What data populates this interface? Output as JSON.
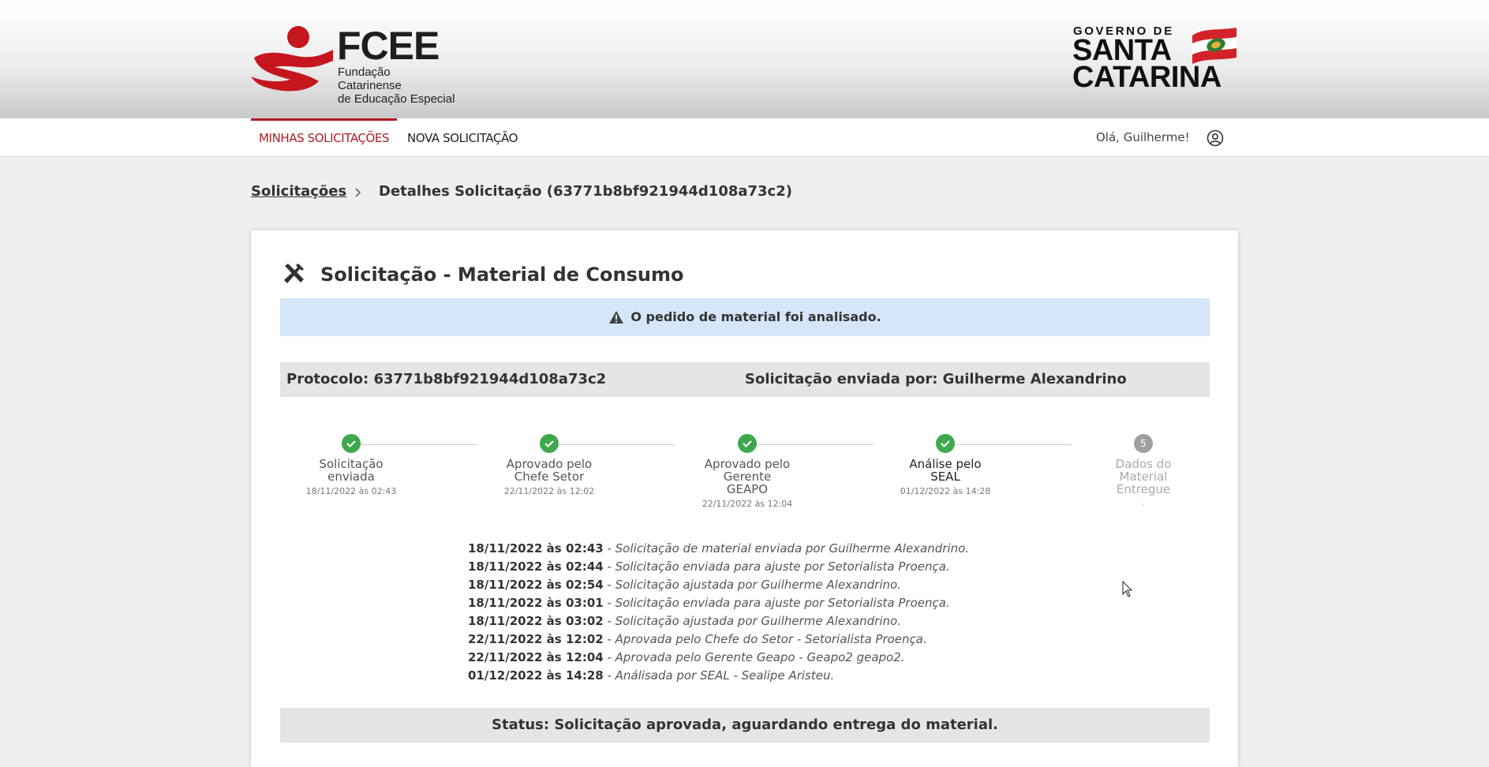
{
  "brand": {
    "fcee_name": "FCEE",
    "fcee_line1": "Fundação Catarinense",
    "fcee_line2": "de Educação Especial",
    "gov_line": "GOVERNO DE",
    "state_line1": "SANTA",
    "state_line2": "CATARINA",
    "accent": "#b11d24"
  },
  "nav": {
    "tabs": [
      {
        "label": "MINHAS SOLICITAÇÕES",
        "active": true
      },
      {
        "label": "NOVA SOLICITAÇÃO",
        "active": false
      }
    ],
    "greeting": "Olá, Guilherme!"
  },
  "breadcrumb": {
    "link": "Solicitações",
    "current": "Detalhes Solicitação (63771b8bf921944d108a73c2)"
  },
  "card": {
    "title": "Solicitação - Material de Consumo",
    "alert": "O pedido de material foi analisado.",
    "protocol": "Protocolo: 63771b8bf921944d108a73c2",
    "sent_by": "Solicitação enviada por: Guilherme Alexandrino",
    "steps": [
      {
        "l1": "Solicitação",
        "l2": "enviada",
        "l3": "",
        "date": "18/11/2022 às 02:43",
        "state": "done"
      },
      {
        "l1": "Aprovado pelo",
        "l2": "Chefe Setor",
        "l3": "",
        "date": "22/11/2022 às 12:02",
        "state": "done"
      },
      {
        "l1": "Aprovado pelo",
        "l2": "Gerente",
        "l3": "GEAPO",
        "date": "22/11/2022 às 12:04",
        "state": "done"
      },
      {
        "l1": "Análise pelo",
        "l2": "SEAL",
        "l3": "",
        "date": "01/12/2022 às 14:28",
        "state": "done"
      },
      {
        "l1": "Dados do",
        "l2": "Material",
        "l3": "Entregue",
        "date": "-",
        "state": "pending",
        "number": "5"
      }
    ],
    "history": [
      {
        "dt": "18/11/2022 às 02:43",
        "sep": " - ",
        "desc": "Solicitação de material enviada por Guilherme Alexandrino."
      },
      {
        "dt": "18/11/2022 às 02:44",
        "sep": " - ",
        "desc": "Solicitação enviada para ajuste por Setorialista Proença."
      },
      {
        "dt": "18/11/2022 às 02:54",
        "sep": " - ",
        "desc": "Solicitação ajustada por Guilherme Alexandrino."
      },
      {
        "dt": "18/11/2022 às 03:01",
        "sep": " - ",
        "desc": "Solicitação enviada para ajuste por Setorialista Proença."
      },
      {
        "dt": "18/11/2022 às 03:02",
        "sep": " - ",
        "desc": "Solicitação ajustada por Guilherme Alexandrino."
      },
      {
        "dt": "22/11/2022 às 12:02",
        "sep": " - ",
        "desc": "Aprovada pelo Chefe do Setor - Setorialista Proença."
      },
      {
        "dt": "22/11/2022 às 12:04",
        "sep": " - ",
        "desc": "Aprovada pelo Gerente Geapo - Geapo2 geapo2."
      },
      {
        "dt": "01/12/2022 às 14:28",
        "sep": " - ",
        "desc": "Análisada por SEAL - Sealipe Aristeu."
      }
    ],
    "status": "Status: Solicitação aprovada, aguardando entrega do material."
  },
  "icons": {
    "tools": "tools-icon",
    "warning": "warning-icon",
    "check": "check-icon",
    "user": "user-circle-icon"
  }
}
